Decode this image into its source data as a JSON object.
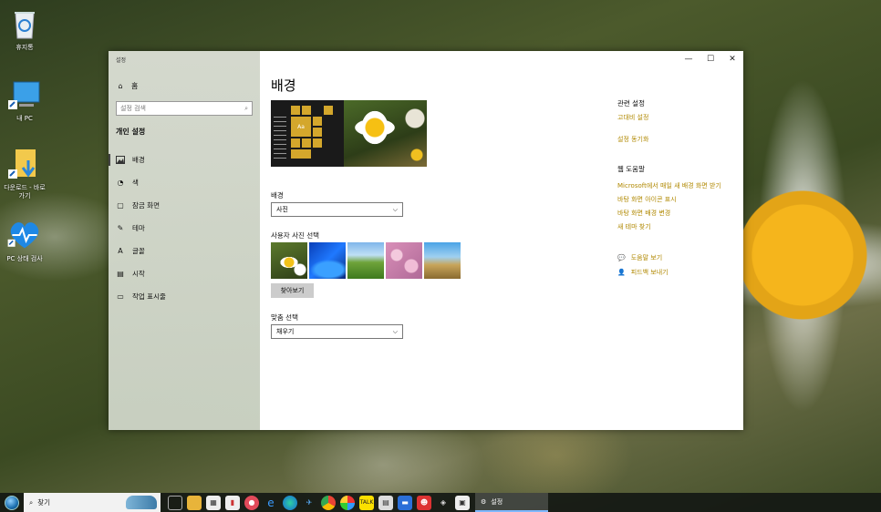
{
  "desktop": {
    "icons": [
      {
        "label": "휴지통"
      },
      {
        "label": "내 PC"
      },
      {
        "label": "다운로드 - 바로 가기"
      },
      {
        "label": "PC 상태 검사"
      }
    ]
  },
  "window": {
    "title": "설정",
    "controls": {
      "minimize": "—",
      "maximize": "☐",
      "close": "✕"
    }
  },
  "sidebar": {
    "home_label": "홈",
    "search_placeholder": "설정 검색",
    "section_title": "개인 설정",
    "items": [
      {
        "label": "배경",
        "icon": "image-icon",
        "active": true
      },
      {
        "label": "색",
        "icon": "palette-icon"
      },
      {
        "label": "잠금 화면",
        "icon": "lock-screen-icon"
      },
      {
        "label": "테마",
        "icon": "theme-icon"
      },
      {
        "label": "글꼴",
        "icon": "font-icon"
      },
      {
        "label": "시작",
        "icon": "start-icon"
      },
      {
        "label": "작업 표시줄",
        "icon": "taskbar-icon"
      }
    ]
  },
  "main": {
    "page_title": "배경",
    "preview_tile_text": "Aa",
    "background_label": "배경",
    "background_value": "사진",
    "choose_photo_label": "사용자 사진 선택",
    "browse_label": "찾아보기",
    "fit_label": "맞춤 선택",
    "fit_value": "채우기"
  },
  "related": {
    "title": "관련 설정",
    "links": [
      "고대비 설정",
      "설정 동기화"
    ]
  },
  "help": {
    "title": "웹 도움말",
    "links": [
      "Microsoft에서 매일 새 배경 화면 받기",
      "바탕 화면 아이콘 표시",
      "바탕 화면 배경 변경",
      "새 테마 찾기"
    ],
    "get_help": "도움말 보기",
    "feedback": "피드백 보내기"
  },
  "taskbar": {
    "search_text": "찾기",
    "active_app": "설정"
  },
  "colors": {
    "accent": "#b08800",
    "sidebar": "#d4d9cd"
  }
}
